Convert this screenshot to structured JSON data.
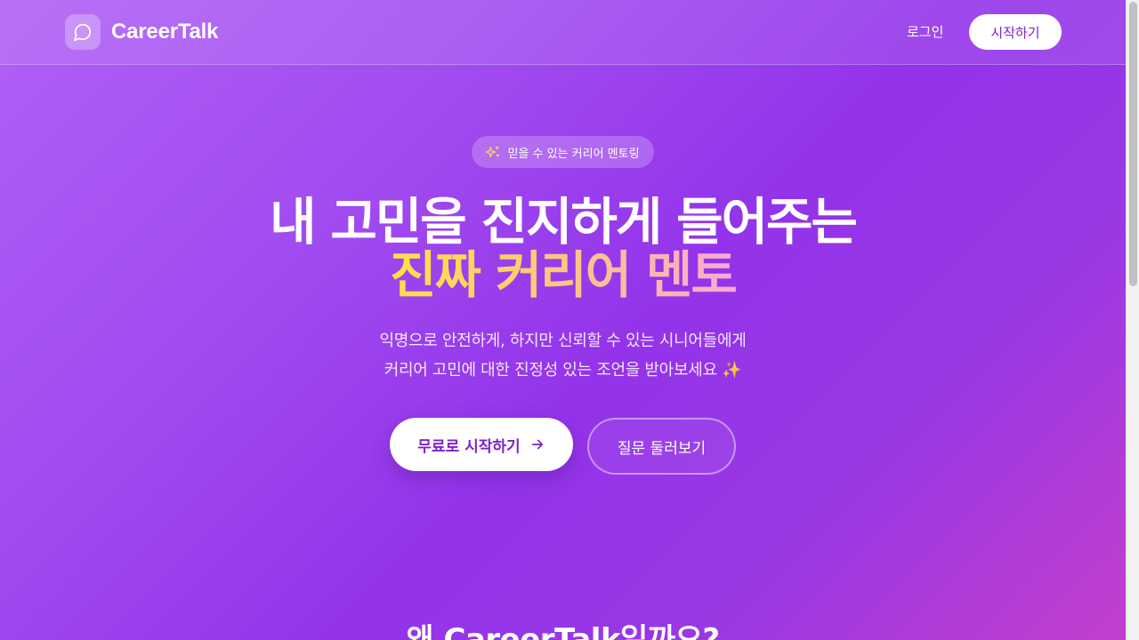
{
  "header": {
    "brand": "CareerTalk",
    "login_label": "로그인",
    "start_label": "시작하기"
  },
  "hero": {
    "badge_text": "믿을 수 있는 커리어 멘토링",
    "title_line1": "내 고민을 진지하게 들어주는",
    "title_line2": "진짜 커리어 멘토",
    "subtitle_line1": "익명으로 안전하게, 하지만 신뢰할 수 있는 시니어들에게",
    "subtitle_line2": "커리어 고민에 대한 진정성 있는 조언을 받아보세요 ✨",
    "primary_cta": "무료로 시작하기",
    "secondary_cta": "질문 둘러보기"
  },
  "features": {
    "section_title": "왜 CareerTalk일까요?"
  },
  "icons": {
    "logo": "message-circle-icon",
    "badge": "sparkles-icon",
    "cta": "arrow-right-icon"
  },
  "colors": {
    "accent": "#7e22ce",
    "background_start": "#b060f6",
    "background_mid": "#9333ea",
    "background_end": "#c43fcd",
    "highlight_start": "#fde047",
    "highlight_end": "#f9a8d4"
  }
}
